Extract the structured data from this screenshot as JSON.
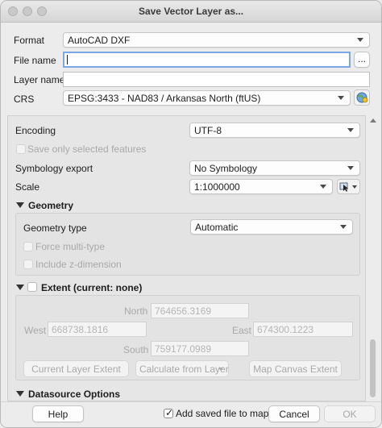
{
  "window": {
    "title": "Save Vector Layer as..."
  },
  "form": {
    "format_label": "Format",
    "format_value": "AutoCAD DXF",
    "filename_label": "File name",
    "filename_value": "",
    "browse_label": "...",
    "layername_label": "Layer name",
    "layername_value": "",
    "crs_label": "CRS",
    "crs_value": "EPSG:3433 - NAD83 / Arkansas North (ftUS)"
  },
  "options": {
    "encoding_label": "Encoding",
    "encoding_value": "UTF-8",
    "save_selected_label": "Save only selected features",
    "symbology_label": "Symbology export",
    "symbology_value": "No Symbology",
    "scale_label": "Scale",
    "scale_value": "1:1000000"
  },
  "geometry": {
    "title": "Geometry",
    "type_label": "Geometry type",
    "type_value": "Automatic",
    "force_multi_label": "Force multi-type",
    "include_z_label": "Include z-dimension"
  },
  "extent": {
    "title": "Extent (current: none)",
    "north_label": "North",
    "north_value": "764656.3169",
    "west_label": "West",
    "west_value": "668738.1816",
    "east_label": "East",
    "east_value": "674300.1223",
    "south_label": "South",
    "south_value": "759177.0989",
    "current_layer_btn": "Current Layer Extent",
    "calc_from_layer_btn": "Calculate from Layer",
    "map_canvas_btn": "Map Canvas Extent"
  },
  "datasource": {
    "title": "Datasource Options"
  },
  "footer": {
    "help_label": "Help",
    "add_saved_label": "Add saved file to map",
    "add_saved_checked": true,
    "cancel_label": "Cancel",
    "ok_label": "OK"
  }
}
